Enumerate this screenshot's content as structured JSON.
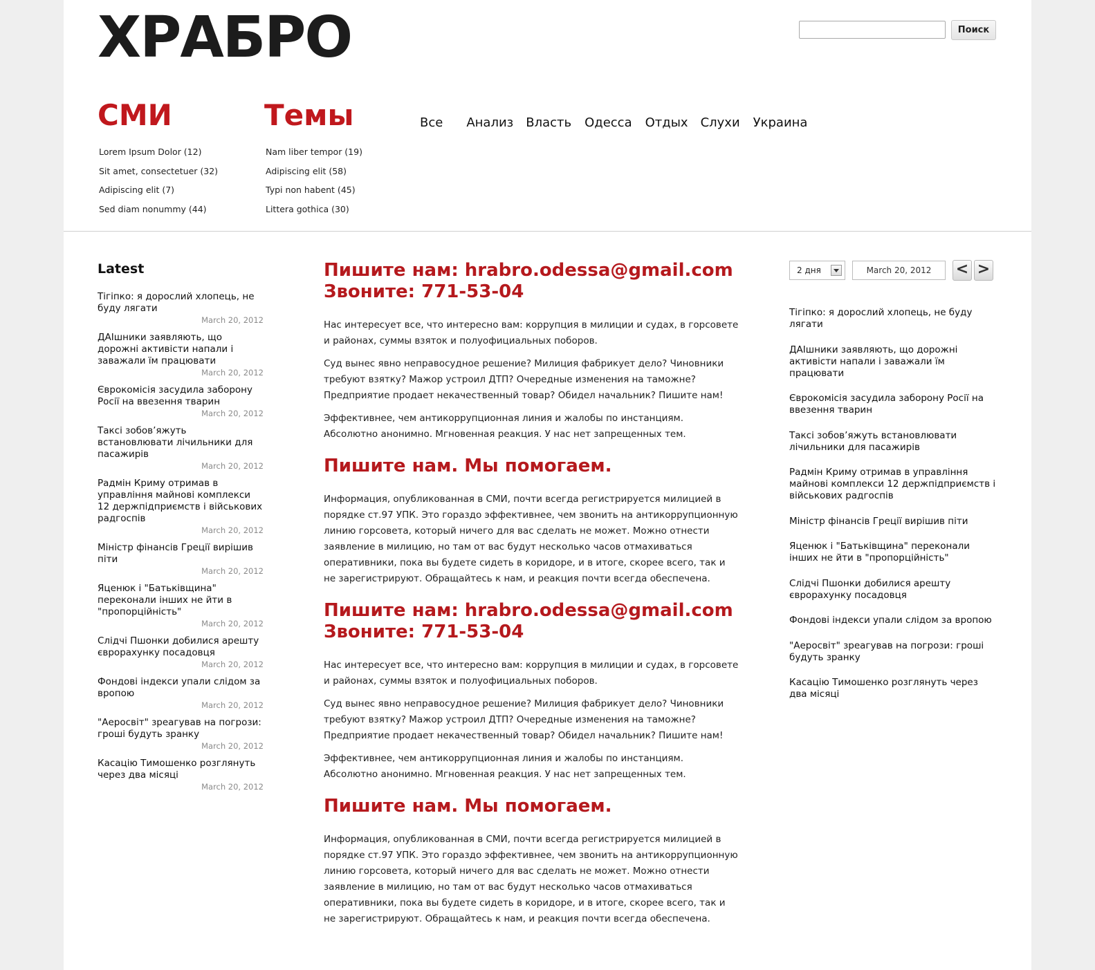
{
  "header": {
    "logo": "ХРАБРО",
    "search": {
      "value": "",
      "placeholder": "",
      "button_label": "Поиск"
    }
  },
  "smi": {
    "title": "СМИ",
    "items": [
      "Lorem Ipsum Dolor (12)",
      "Sit amet, consectetuer (32)",
      "Adipiscing elit (7)",
      "Sed diam nonummy (44)"
    ]
  },
  "themes": {
    "title": "Темы",
    "items": [
      "Nam liber tempor (19)",
      "Adipiscing elit (58)",
      "Typi non habent (45)",
      "Littera gothica (30)"
    ]
  },
  "topics": [
    "Все",
    "Анализ",
    "Власть",
    "Одесса",
    "Отдых",
    "Слухи",
    "Украина"
  ],
  "latest": {
    "title": "Latest",
    "items": [
      {
        "title": "Тігіпко: я дорослий хлопець, не буду лягати",
        "date": "March 20, 2012"
      },
      {
        "title": "ДАІшники заявляють, що дорожні активісти напали і заважали їм працювати",
        "date": "March 20, 2012"
      },
      {
        "title": "Єврокомісія засудила заборону Росії на ввезення тварин",
        "date": "March 20, 2012"
      },
      {
        "title": "Таксі зобов’яжуть встановлювати лічильники для пасажирів",
        "date": "March 20, 2012"
      },
      {
        "title": "Радмін Криму отримав в управління майнові комплекси 12 держпідприємств і військових радгоспів",
        "date": "March 20, 2012"
      },
      {
        "title": "Міністр фінансів Греції вирішив піти",
        "date": "March 20, 2012"
      },
      {
        "title": "Яценюк і \"Батьківщина\" переконали інших не йти в \"пропорційність\"",
        "date": "March 20, 2012"
      },
      {
        "title": "Слідчі Пшонки добилися арешту єврорахунку посадовця",
        "date": "March 20, 2012"
      },
      {
        "title": "Фондові індекси упали слідом за вропою",
        "date": "March 20, 2012"
      },
      {
        "title": "\"Аеросвіт\" зреагував на погрози: гроші будуть зранку",
        "date": "March 20, 2012"
      },
      {
        "title": "Касацію Тимошенко розглянуть через два місяці",
        "date": "March 20, 2012"
      }
    ]
  },
  "content": {
    "blocks": [
      {
        "heading": "Пишите нам: hrabro.odessa@gmail.com",
        "subheading": "Звоните: 771-53-04",
        "paragraphs": [
          "Нас интересует все, что интересно вам: коррупция в милиции и судах, в горсовете и районах, суммы взяток и полуофициальных поборов.",
          "Суд вынес явно неправосудное решение? Милиция фабрикует дело? Чиновники требуют взятку? Мажор устроил ДТП? Очередные изменения на таможне? Предприятие продает некачественный товар? Обидел начальник? Пишите нам!",
          "Эффективнее, чем антикоррупционная линия и жалобы по инстанциям. Абсолютно анонимно. Мгновенная реакция. У нас нет запрещенных тем."
        ]
      },
      {
        "heading": "Пишите нам. Мы помогаем.",
        "paragraphs": [
          "Информация, опубликованная в СМИ, почти всегда регистрируется милицией в порядке ст.97 УПК. Это гораздо эффективнее, чем звонить на антикоррупционную линию горсовета, который ничего для вас сделать не может. Можно отнести заявление в милицию, но там от вас будут несколько часов отмахиваться оперативники, пока вы будете сидеть в коридоре, и в итоге, скорее всего, так и не зарегистрируют. Обращайтесь к нам, и реакция почти всегда обеспечена."
        ]
      },
      {
        "heading": "Пишите нам: hrabro.odessa@gmail.com",
        "subheading": "Звоните: 771-53-04",
        "paragraphs": [
          "Нас интересует все, что интересно вам: коррупция в милиции и судах, в горсовете и районах, суммы взяток и полуофициальных поборов.",
          "Суд вынес явно неправосудное решение? Милиция фабрикует дело? Чиновники требуют взятку? Мажор устроил ДТП? Очередные изменения на таможне? Предприятие продает некачественный товар? Обидел начальник? Пишите нам!",
          "Эффективнее, чем антикоррупционная линия и жалобы по инстанциям. Абсолютно анонимно. Мгновенная реакция. У нас нет запрещенных тем."
        ]
      },
      {
        "heading": "Пишите нам. Мы помогаем.",
        "paragraphs": [
          "Информация, опубликованная в СМИ, почти всегда регистрируется милицией в порядке ст.97 УПК. Это гораздо эффективнее, чем звонить на антикоррупционную линию горсовета, который ничего для вас сделать не может. Можно отнести заявление в милицию, но там от вас будут несколько часов отмахиваться оперативники, пока вы будете сидеть в коридоре, и в итоге, скорее всего, так и не зарегистрируют. Обращайтесь к нам, и реакция почти всегда обеспечена."
        ]
      }
    ]
  },
  "sidebar_right": {
    "period_select": "2 дня",
    "date": "March 20, 2012",
    "prev_label": "<",
    "next_label": ">",
    "items": [
      "Тігіпко: я дорослий хлопець, не буду лягати",
      "ДАІшники заявляють, що дорожні активісти напали і заважали їм працювати",
      "Єврокомісія засудила заборону Росії на ввезення тварин",
      "Таксі зобов’яжуть встановлювати лічильники для пасажирів",
      "Радмін Криму отримав в управління майнові комплекси 12 держпідприємств і військових радгоспів",
      "Міністр фінансів Греції вирішив піти",
      "Яценюк і \"Батьківщина\" переконали інших не йти в \"пропорційність\"",
      "Слідчі Пшонки добилися арешту єврорахунку посадовця",
      "Фондові індекси упали слідом за вропою",
      "\"Аеросвіт\" зреагував на погрози: гроші будуть зранку",
      "Касацію Тимошенко розглянуть через два місяці"
    ]
  },
  "colors": {
    "accent": "#c0181d",
    "heading": "#b5191d",
    "date": "#8a8a8a"
  }
}
